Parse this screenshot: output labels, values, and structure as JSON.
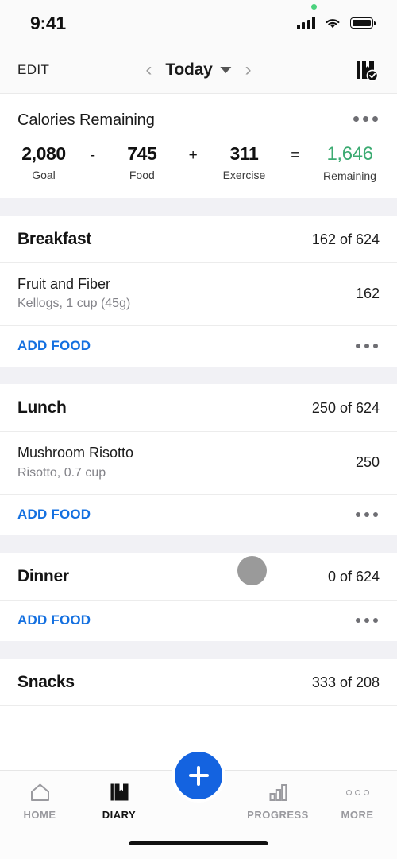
{
  "status_bar": {
    "time": "9:41",
    "signal_icon": "cellular-signal-icon",
    "wifi_icon": "wifi-icon",
    "battery_icon": "battery-full-icon",
    "privacy_indicator": "green-recording-dot"
  },
  "nav": {
    "edit_label": "EDIT",
    "prev_icon": "chevron-left-icon",
    "date_label": "Today",
    "dropdown_icon": "caret-down-icon",
    "next_icon": "chevron-right-icon",
    "complete_entry_icon": "book-check-icon"
  },
  "calories": {
    "title": "Calories Remaining",
    "menu_icon": "overflow-menu-icon",
    "goal_value": "2,080",
    "goal_label": "Goal",
    "op_minus": "-",
    "food_value": "745",
    "food_label": "Food",
    "op_plus": "+",
    "exercise_value": "311",
    "exercise_label": "Exercise",
    "op_equals": "=",
    "remaining_value": "1,646",
    "remaining_label": "Remaining",
    "remaining_color": "#3cab72"
  },
  "meals": [
    {
      "name": "Breakfast",
      "count": "162 of 624",
      "foods": [
        {
          "name": "Fruit and Fiber",
          "desc": "Kellogs, 1 cup (45g)",
          "calories": "162"
        }
      ],
      "add_food_label": "ADD FOOD",
      "menu_icon": "overflow-menu-icon"
    },
    {
      "name": "Lunch",
      "count": "250 of 624",
      "foods": [
        {
          "name": "Mushroom Risotto",
          "desc": "Risotto, 0.7 cup",
          "calories": "250"
        }
      ],
      "add_food_label": "ADD FOOD",
      "menu_icon": "overflow-menu-icon"
    },
    {
      "name": "Dinner",
      "count": "0 of 624",
      "foods": [],
      "add_food_label": "ADD FOOD",
      "menu_icon": "overflow-menu-icon"
    },
    {
      "name": "Snacks",
      "count": "333 of 208",
      "foods": [],
      "add_food_label": "",
      "menu_icon": ""
    }
  ],
  "tabbar": {
    "items": [
      {
        "label": "HOME",
        "icon": "home-icon",
        "active": false
      },
      {
        "label": "DIARY",
        "icon": "book-icon",
        "active": true
      },
      {
        "label": "PROGRESS",
        "icon": "bar-chart-icon",
        "active": false
      },
      {
        "label": "MORE",
        "icon": "more-dots-icon",
        "active": false
      }
    ],
    "fab_icon": "plus-icon",
    "fab_color": "#1463e0",
    "home_indicator": "home-indicator-bar"
  },
  "theme": {
    "accent_blue": "#1470e0",
    "accent_green": "#3cab72",
    "band_gray": "#f1f1f5"
  }
}
